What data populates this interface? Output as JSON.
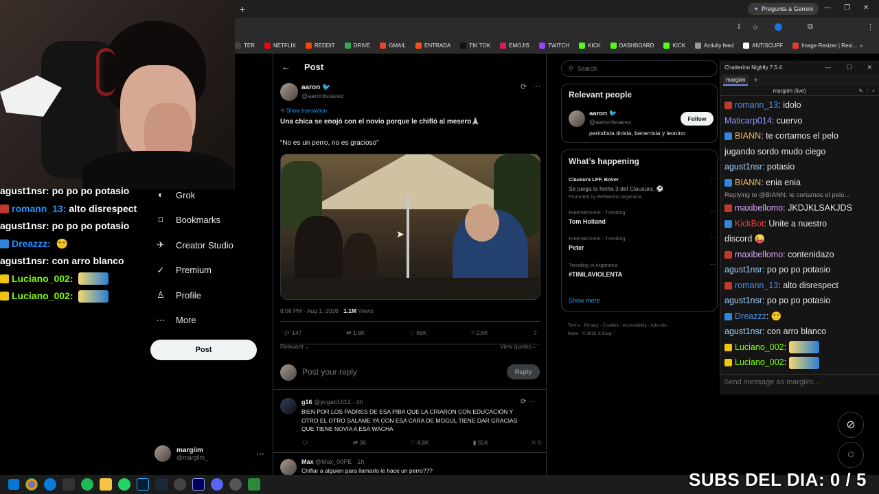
{
  "browser": {
    "gemini_label": "Pregunta a Gemini",
    "bookmarks": [
      {
        "label": "TER",
        "color": "#444"
      },
      {
        "label": "NETFLIX",
        "color": "#e50914"
      },
      {
        "label": "REDDIT",
        "color": "#ff4500"
      },
      {
        "label": "DRIVE",
        "color": "#34a853"
      },
      {
        "label": "GMAIL",
        "color": "#ea4335"
      },
      {
        "label": "ENTRADA",
        "color": "#f4511e"
      },
      {
        "label": "TIK TOK",
        "color": "#111"
      },
      {
        "label": "EMOJIS",
        "color": "#d81b60"
      },
      {
        "label": "TWITCH",
        "color": "#9146ff"
      },
      {
        "label": "KICK",
        "color": "#53fc18"
      },
      {
        "label": "DASHBOARD",
        "color": "#53fc18"
      },
      {
        "label": "KICK",
        "color": "#53fc18"
      },
      {
        "label": "Activity feed",
        "color": "#999"
      },
      {
        "label": "ANTISCUFF",
        "color": "#fff"
      },
      {
        "label": "Image Resizer | Resi...",
        "color": "#e53935"
      }
    ]
  },
  "overlay_chat": [
    {
      "text": "agust1nsr: po po po potasio",
      "badge": ""
    },
    {
      "text": "romann_13: alto disrespect",
      "badge": "#c0392b",
      "user_color": "#1e90ff"
    },
    {
      "text": "agust1nsr: po po po potasio",
      "badge": ""
    },
    {
      "text": "Dreazzz: ",
      "badge": "#2e86de",
      "user_color": "#1e90ff",
      "emote": "😵‍💫"
    },
    {
      "text": "agust1nsr: con arro blanco",
      "badge": ""
    },
    {
      "text": "Luciano_002: ",
      "badge": "#f1c40f",
      "user_color": "#7fff00",
      "img": true
    },
    {
      "text": "Luciano_002: ",
      "badge": "#f1c40f",
      "user_color": "#7fff00",
      "img": true
    }
  ],
  "nav": [
    {
      "label": "Grok",
      "icon": "◐"
    },
    {
      "label": "Bookmarks",
      "icon": "⌑"
    },
    {
      "label": "Creator Studio",
      "icon": "✈"
    },
    {
      "label": "Premium",
      "icon": "✓"
    },
    {
      "label": "Profile",
      "icon": "♙"
    },
    {
      "label": "More",
      "icon": "⋯"
    }
  ],
  "post_button": "Post",
  "me": {
    "name": "margiim",
    "handle": "@margiim_"
  },
  "post": {
    "header": "Post",
    "author": "aaron 🐦",
    "handle": "@aarontsuarez",
    "show_translation": "Show translation",
    "text1": "Una chica se enojó con el novio porque le chifló al mesero🙏🏻",
    "text2": "“No es un perro, no es gracioso”",
    "timestamp": "8:08 PM · Aug 1, 2026 · ",
    "views_count": "1.1M",
    "views_label": " Views",
    "replies": "147",
    "reposts": "1.8K",
    "likes": "69K",
    "bookmarks": "2.6K",
    "relevant": "Relevant",
    "view_quotes": "View quotes ›",
    "reply_placeholder": "Post your reply",
    "reply_button": "Reply"
  },
  "replies": [
    {
      "name": "g16",
      "handle": "@yogab1612 · 4h",
      "text": "BIEN POR LOS PADRES DE ESA PIBA QUE LA CRIARON CON EDUCACIÓN Y OTRO EL OTRO SALAME YA CON ESA CARA DE MOGUL TIENE DAR GRACIAS QUE TIENE NOVIA A ESA WACHA",
      "reposts": "36",
      "likes": "4.8K",
      "views": "55K"
    },
    {
      "name": "Max",
      "handle": "@Max_00PE · 1h",
      "text": "Chiflar a alguien para llamarlo le hace un perro???"
    }
  ],
  "right": {
    "search_placeholder": "Search",
    "relevant_title": "Relevant people",
    "person_name": "aaron 🐦",
    "person_handle": "@aarontsuarez",
    "person_bio": "periodista tinista, becerrista y leonino",
    "follow": "Follow",
    "happening_title": "What’s happening",
    "trends": [
      {
        "cat": "Clausura LPF, Bover",
        "title": "Se juega la fecha 3 del Clausura. ⚽",
        "sub": "Promoted by BetWarrior Argentina"
      },
      {
        "cat": "Entertainment · Trending",
        "title": "Tom Holland"
      },
      {
        "cat": "Entertainment · Trending",
        "title": "Peter"
      },
      {
        "cat": "Trending in Argentina",
        "title": "#TINILAVIOLENTA"
      }
    ],
    "show_more": "Show more",
    "footer1": "Terms  ·  Privacy  ·  Cookies  ·  Accessibility  ·  Ads info  ·",
    "footer2": "More  ·  © 2026 X Corp."
  },
  "chatterino": {
    "title": "Chatterino Nightly 7.5.4",
    "tab": "margiim",
    "channel": "margiim (live)",
    "input_placeholder": "Send message as margiim...",
    "messages": [
      {
        "user": "romann_13",
        "color": "#4a90e2",
        "text": " idolo",
        "badge": "#c0392b"
      },
      {
        "user": "Maticarp014",
        "color": "#8a9bff",
        "text": " cuervo"
      },
      {
        "user": "BIANN",
        "color": "#f0b35a",
        "text": " te cortamos el pelo",
        "cont": "jugando sordo mudo ciego",
        "badge": "#2e86de"
      },
      {
        "user": "agust1nsr",
        "color": "#9fd3ff",
        "text": " potasio"
      },
      {
        "user": "BIANN",
        "color": "#f0b35a",
        "text": " enia enia",
        "badge": "#2e86de"
      },
      {
        "reply": "Replying to @BIANN: te cortamos el pelo..."
      },
      {
        "user": "maxibellomo",
        "color": "#d9a6ff",
        "text": " JKDJKLSAKJDS",
        "badge": "#c0392b"
      },
      {
        "user": "KickBot",
        "color": "#ff3b3b",
        "text": " Unite a nuestro",
        "cont": "discord 😜",
        "badge": "#2e86de"
      },
      {
        "user": "maxibellomo",
        "color": "#d9a6ff",
        "text": " contenidazo",
        "badge": "#c0392b"
      },
      {
        "user": "agust1nsr",
        "color": "#9fd3ff",
        "text": " po po po potasio"
      },
      {
        "user": "romann_13",
        "color": "#4a90e2",
        "text": " alto disrespect",
        "badge": "#c0392b"
      },
      {
        "user": "agust1nsr",
        "color": "#9fd3ff",
        "text": " po po po potasio"
      },
      {
        "user": "Dreazzz",
        "color": "#4a90e2",
        "text": " 😵‍💫",
        "badge": "#2e86de"
      },
      {
        "user": "agust1nsr",
        "color": "#9fd3ff",
        "text": " con arro blanco"
      },
      {
        "user": "Luciano_002",
        "color": "#7fff00",
        "text": " ",
        "badge": "#f1c40f",
        "img": true
      },
      {
        "user": "Luciano_002",
        "color": "#7fff00",
        "text": " ",
        "badge": "#f1c40f",
        "img": true
      }
    ]
  },
  "stream_overlay": {
    "subs": "SUBS DEL DIA: 0 / 5"
  }
}
